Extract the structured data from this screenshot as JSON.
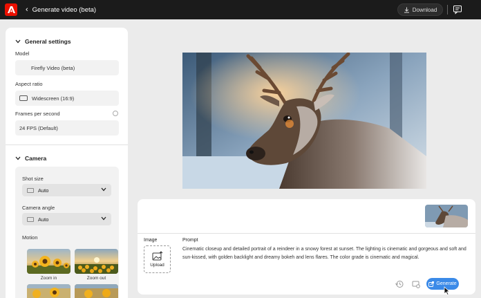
{
  "topbar": {
    "title": "Generate video (beta)",
    "download_label": "Download"
  },
  "left_panel": {
    "general_settings": {
      "heading": "General settings",
      "model_label": "Model",
      "model_value": "Firefly Video (beta)",
      "aspect_label": "Aspect ratio",
      "aspect_value": "Widescreen (16:9)",
      "fps_label": "Frames per second",
      "fps_value": "24 FPS (Default)"
    },
    "camera": {
      "heading": "Camera",
      "shot_size_label": "Shot size",
      "shot_size_value": "Auto",
      "camera_angle_label": "Camera angle",
      "camera_angle_value": "Auto",
      "motion_label": "Motion",
      "motion_options": [
        {
          "label": "Zoom in"
        },
        {
          "label": "Zoom out"
        }
      ]
    }
  },
  "prompt_panel": {
    "image_label": "Image",
    "upload_label": "Upload",
    "prompt_label": "Prompt",
    "prompt_text": "Cinematic closeup and detailed portrait of a reindeer in a snowy forest at sunset. The lighting is cinematic and gorgeous and soft and sun-kissed, with golden backlight and dreamy bokeh and lens flares. The color grade is cinematic and magical.",
    "generate_label": "Generate"
  },
  "colors": {
    "accent": "#3b8ae8",
    "brand": "#eb1000",
    "topbar": "#1b1b1b"
  }
}
